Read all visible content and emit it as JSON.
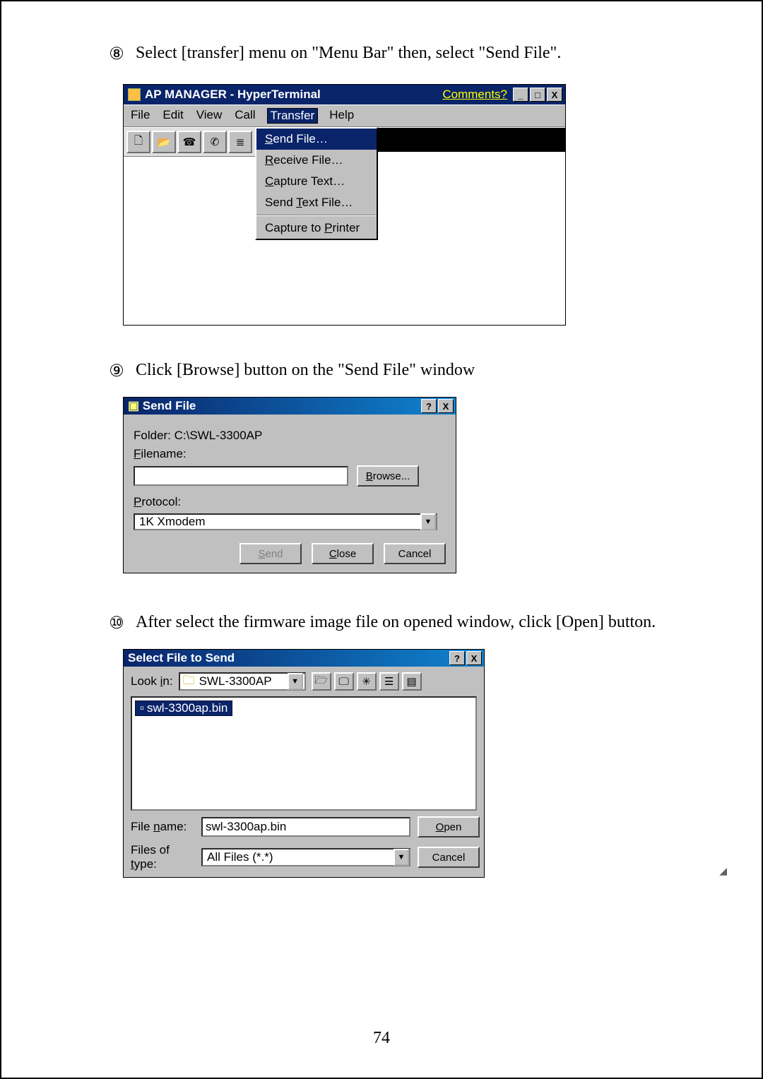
{
  "page_number": "74",
  "steps": {
    "s8": {
      "num": "⑧",
      "text": "Select [transfer] menu on \"Menu Bar\" then, select \"Send File\"."
    },
    "s9": {
      "num": "⑨",
      "text": "Click [Browse] button on the \"Send File\" window"
    },
    "s10": {
      "num": "⑩",
      "text": "After select the firmware image file on opened window, click [Open] button."
    }
  },
  "hyperterm": {
    "title": "AP MANAGER - HyperTerminal",
    "comments": "Comments?",
    "menu": {
      "file": "File",
      "edit": "Edit",
      "view": "View",
      "call": "Call",
      "transfer": "Transfer",
      "help": "Help"
    },
    "dropdown": {
      "send_file": "Send File…",
      "receive_file": "Receive File…",
      "capture_text": "Capture Text…",
      "send_text_file": "Send Text File…",
      "capture_to_printer": "Capture to Printer"
    }
  },
  "sendfile": {
    "title": "Send File",
    "folder_label": "Folder:  C:\\SWL-3300AP",
    "filename_label": "Filename:",
    "filename_value": "",
    "browse": "Browse...",
    "protocol_label": "Protocol:",
    "protocol_value": "1K Xmodem",
    "send": "Send",
    "close": "Close",
    "cancel": "Cancel"
  },
  "opendlg": {
    "title": "Select File to Send",
    "look_in_label": "Look in:",
    "look_in_value": "SWL-3300AP",
    "file_item": "swl-3300ap.bin",
    "file_name_label": "File name:",
    "file_name_value": "swl-3300ap.bin",
    "files_of_type_label": "Files of type:",
    "files_of_type_value": "All Files (*.*)",
    "open": "Open",
    "cancel": "Cancel"
  },
  "winicons": {
    "min": "_",
    "max": "□",
    "close": "X",
    "help": "?",
    "drop": "▼"
  }
}
